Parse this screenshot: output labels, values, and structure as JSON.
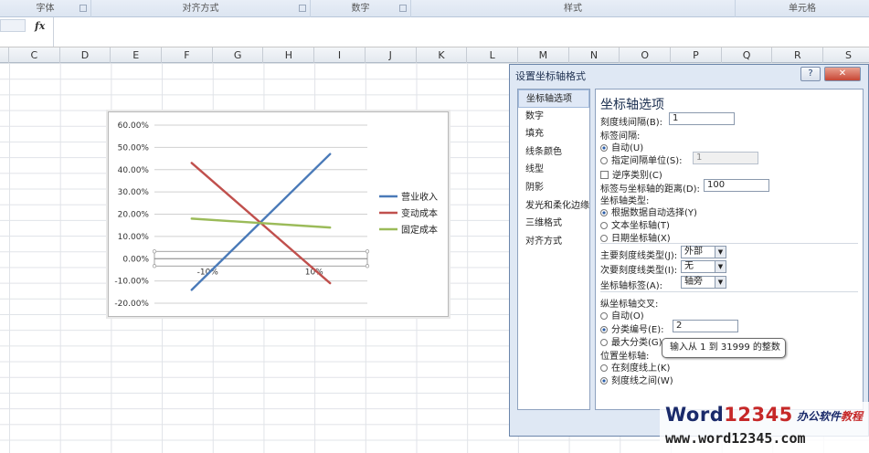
{
  "ribbon": {
    "groups": [
      {
        "label": "字体"
      },
      {
        "label": "对齐方式"
      },
      {
        "label": "数字"
      },
      {
        "label": "样式"
      },
      {
        "label": "单元格"
      }
    ]
  },
  "formula_bar": {
    "fx_label": "fx",
    "value": ""
  },
  "columns": [
    "C",
    "D",
    "E",
    "F",
    "G",
    "H",
    "I",
    "J",
    "K",
    "L",
    "M",
    "N",
    "O",
    "P",
    "Q",
    "R",
    "S"
  ],
  "chart_data": {
    "type": "line",
    "x": [
      -0.2,
      0.2
    ],
    "series": [
      {
        "name": "营业收入",
        "color": "#4a7ab8",
        "points": [
          [
            -0.13,
            -0.14
          ],
          [
            0.13,
            0.47
          ]
        ]
      },
      {
        "name": "变动成本",
        "color": "#c0504d",
        "points": [
          [
            -0.13,
            0.43
          ],
          [
            0.13,
            -0.11
          ]
        ]
      },
      {
        "name": "固定成本",
        "color": "#9bbb59",
        "points": [
          [
            -0.13,
            0.18
          ],
          [
            0.13,
            0.14
          ]
        ]
      }
    ],
    "y_ticks": [
      "60.00%",
      "50.00%",
      "40.00%",
      "30.00%",
      "20.00%",
      "10.00%",
      "0.00%",
      "-10.00%",
      "-20.00%"
    ],
    "x_tick_labels": [
      "-10%",
      "10%"
    ],
    "ylim": [
      -0.2,
      0.6
    ],
    "xlim": [
      -0.2,
      0.2
    ],
    "legend": "right",
    "grid": true
  },
  "dialog": {
    "title": "设置坐标轴格式",
    "help_label": "?",
    "close_label": "✕",
    "nav": [
      "坐标轴选项",
      "数字",
      "填充",
      "线条颜色",
      "线型",
      "阴影",
      "发光和柔化边缘",
      "三维格式",
      "对齐方式"
    ],
    "selected_nav": 0,
    "panel": {
      "heading": "坐标轴选项",
      "tick_interval_label": "刻度线间隔(B):",
      "tick_interval_value": "1",
      "label_interval_label": "标签间隔:",
      "auto_label": "自动(U)",
      "specify_label": "指定间隔单位(S):",
      "specify_value": "1",
      "reverse_label": "逆序类别(C)",
      "label_distance_label": "标签与坐标轴的距离(D):",
      "label_distance_value": "100",
      "axis_type_label": "坐标轴类型:",
      "axis_type_auto": "根据数据自动选择(Y)",
      "axis_type_text": "文本坐标轴(T)",
      "axis_type_date": "日期坐标轴(X)",
      "major_tick_label": "主要刻度线类型(J):",
      "major_tick_value": "外部",
      "minor_tick_label": "次要刻度线类型(I):",
      "minor_tick_value": "无",
      "axis_labels_label": "坐标轴标签(A):",
      "axis_labels_value": "轴旁",
      "cross_label": "纵坐标轴交叉:",
      "cross_auto": "自动(O)",
      "cross_category": "分类编号(E):",
      "cross_category_value": "2",
      "cross_max": "最大分类(G)",
      "position_label": "位置坐标轴:",
      "position_on": "在刻度线上(K)",
      "position_between": "刻度线之间(W)"
    },
    "tooltip": "输入从 1 到 31999 的整数"
  },
  "watermark": {
    "brand_word": "Word",
    "brand_digits": "12345",
    "cn_part1": "办公软件",
    "cn_part2": "教程",
    "url": "www.word12345.com"
  }
}
